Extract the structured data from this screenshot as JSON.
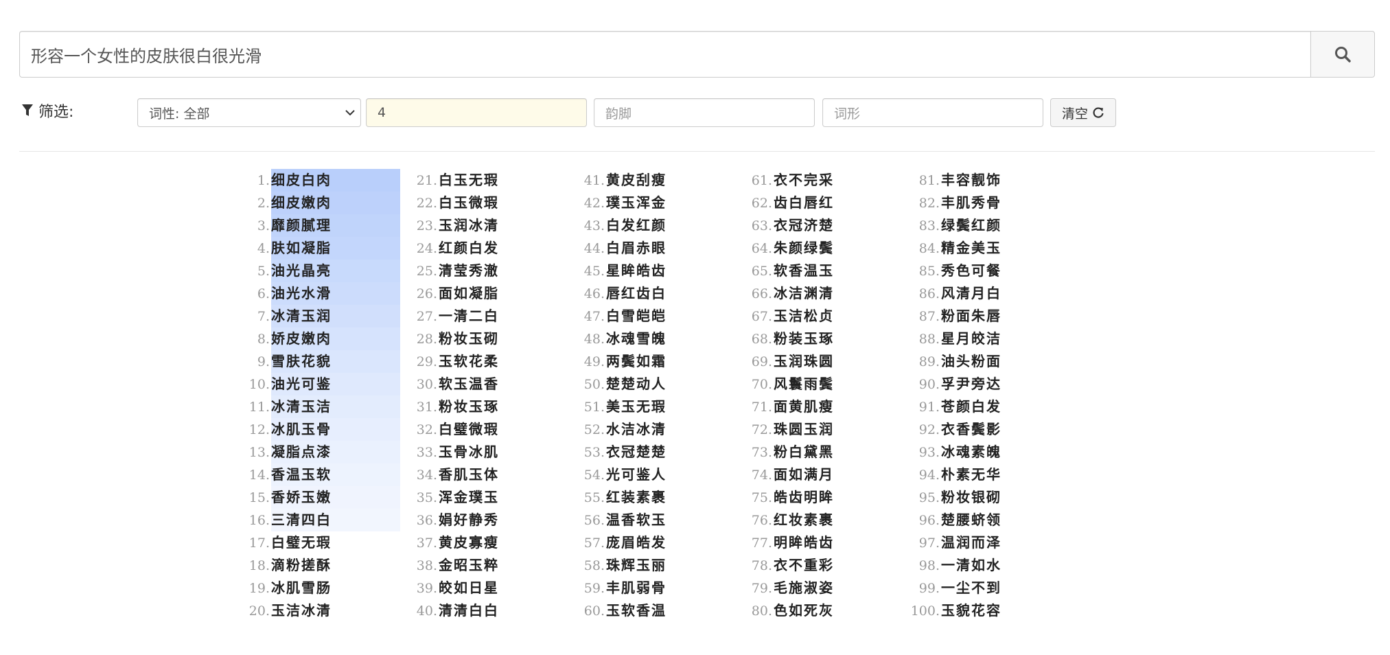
{
  "search": {
    "query": "形容一个女性的皮肤很白很光滑"
  },
  "filters": {
    "label": "筛选:",
    "pos_select_value": "词性: 全部",
    "length_value": "4",
    "rhyme_placeholder": "韵脚",
    "shape_placeholder": "词形",
    "clear_label": "清空"
  },
  "colors": {
    "highlight": "#b9cffb",
    "length_input_bg": "#fefbe9"
  },
  "highlight_strengths": [
    1.0,
    0.95,
    0.9,
    0.85,
    0.78,
    0.72,
    0.66,
    0.58,
    0.52,
    0.46,
    0.4,
    0.35,
    0.3,
    0.26,
    0.22,
    0.18
  ],
  "results": [
    "细皮白肉",
    "细皮嫩肉",
    "靡颜腻理",
    "肤如凝脂",
    "油光晶亮",
    "油光水滑",
    "冰清玉润",
    "娇皮嫩肉",
    "雪肤花貌",
    "油光可鉴",
    "冰清玉洁",
    "冰肌玉骨",
    "凝脂点漆",
    "香温玉软",
    "香娇玉嫩",
    "三清四白",
    "白璧无瑕",
    "滴粉搓酥",
    "冰肌雪肠",
    "玉洁冰清",
    "白玉无瑕",
    "白玉微瑕",
    "玉润冰清",
    "红颜白发",
    "清莹秀澈",
    "面如凝脂",
    "一清二白",
    "粉妆玉砌",
    "玉软花柔",
    "软玉温香",
    "粉妆玉琢",
    "白璧微瑕",
    "玉骨冰肌",
    "香肌玉体",
    "浑金璞玉",
    "娟好静秀",
    "黄皮寡瘦",
    "金昭玉粹",
    "皎如日星",
    "清清白白",
    "黄皮刮瘦",
    "璞玉浑金",
    "白发红颜",
    "白眉赤眼",
    "星眸皓齿",
    "唇红齿白",
    "白雪皑皑",
    "冰魂雪魄",
    "两鬓如霜",
    "楚楚动人",
    "美玉无瑕",
    "水洁冰清",
    "衣冠楚楚",
    "光可鉴人",
    "红装素裹",
    "温香软玉",
    "庞眉皓发",
    "珠辉玉丽",
    "丰肌弱骨",
    "玉软香温",
    "衣不完采",
    "齿白唇红",
    "衣冠济楚",
    "朱颜绿鬓",
    "软香温玉",
    "冰洁渊清",
    "玉洁松贞",
    "粉装玉琢",
    "玉润珠圆",
    "风鬟雨鬓",
    "面黄肌瘦",
    "珠圆玉润",
    "粉白黛黑",
    "面如满月",
    "皓齿明眸",
    "红妆素裹",
    "明眸皓齿",
    "衣不重彩",
    "毛施淑姿",
    "色如死灰",
    "丰容靓饰",
    "丰肌秀骨",
    "绿鬓红颜",
    "精金美玉",
    "秀色可餐",
    "风清月白",
    "粉面朱唇",
    "星月皎洁",
    "油头粉面",
    "孚尹旁达",
    "苍颜白发",
    "衣香鬓影",
    "冰魂素魄",
    "朴素无华",
    "粉妆银砌",
    "楚腰蛴领",
    "温润而泽",
    "一清如水",
    "一尘不到",
    "玉貌花容"
  ]
}
